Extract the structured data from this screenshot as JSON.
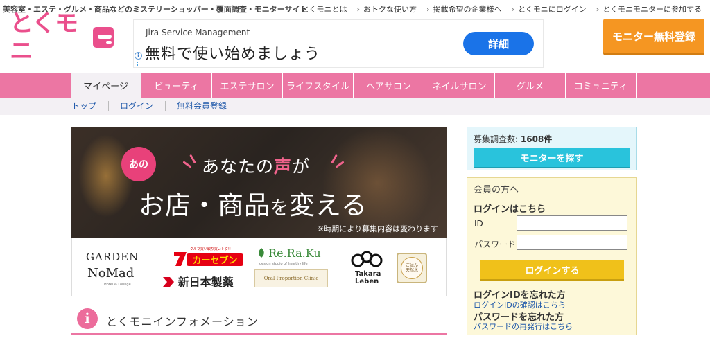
{
  "header": {
    "tagline": "美容室・エステ・グルメ・商品などのミステリーショッパー・覆面調査・モニターサイト",
    "top_links": [
      "とくモニとは",
      "おトクな使い方",
      "掲載希望の企業様へ",
      "とくモニにログイン",
      "とくモニモニターに参加する"
    ],
    "logo_text": "とくモニ",
    "cta_label": "モニター無料登録"
  },
  "ad": {
    "sub": "Jira Service Management",
    "main": "無料で使い始めましょう",
    "button": "詳細",
    "info_glyph": "i"
  },
  "nav": {
    "items": [
      "マイページ",
      "ビューティ",
      "エステサロン",
      "ライフスタイル",
      "ヘアサロン",
      "ネイルサロン",
      "グルメ",
      "コミュニティ"
    ],
    "active_index": 0
  },
  "subnav": {
    "items": [
      "トップ",
      "ログイン",
      "無料会員登録"
    ]
  },
  "hero": {
    "badge": "あの",
    "line1_a": "あなたの",
    "line1_accent": "声",
    "line1_b": "が",
    "line2_a": "お店・商品",
    "line2_small": "を",
    "line2_b": "変える",
    "note": "※時期により募集内容は変わります"
  },
  "logos": {
    "garden": "GARDEN",
    "nomad": "NoMad",
    "nomad_sub": "Hotel & Lounge",
    "kaseven_tag": "クルマ買い取り買いトク!!",
    "kaseven": "カーセブン",
    "shinnihon": "新日本製薬",
    "reraku": "Re.Ra.Ku",
    "reraku_sub": "design studio of healthy life",
    "oral": "Oral Proportion Clinic",
    "takara": "Takara\nLeben",
    "round_seal": "ごはん\n天然水"
  },
  "info": {
    "icon": "i",
    "title": "とくモニインフォメーション"
  },
  "sidebar": {
    "count_label": "募集調査数:",
    "count_value": "1608件",
    "search_button": "モニターを探す",
    "member_head": "会員の方へ",
    "login_title": "ログインはこちら",
    "id_label": "ID",
    "password_label": "パスワード",
    "id_value": "",
    "password_value": "",
    "login_button": "ログインする",
    "forgot_id_title": "ログインIDを忘れた方",
    "forgot_id_link": "ログインIDの確認はこちら",
    "forgot_pw_title": "パスワードを忘れた方",
    "forgot_pw_link": "パスワードの再発行はこちら"
  },
  "colors": {
    "brand_pink": "#ea4f8c",
    "nav_pink": "#ec76a3",
    "cta_orange": "#f59622",
    "ad_blue": "#1a73e8",
    "search_cyan": "#29c3dc",
    "login_yellow": "#f0c11a"
  }
}
